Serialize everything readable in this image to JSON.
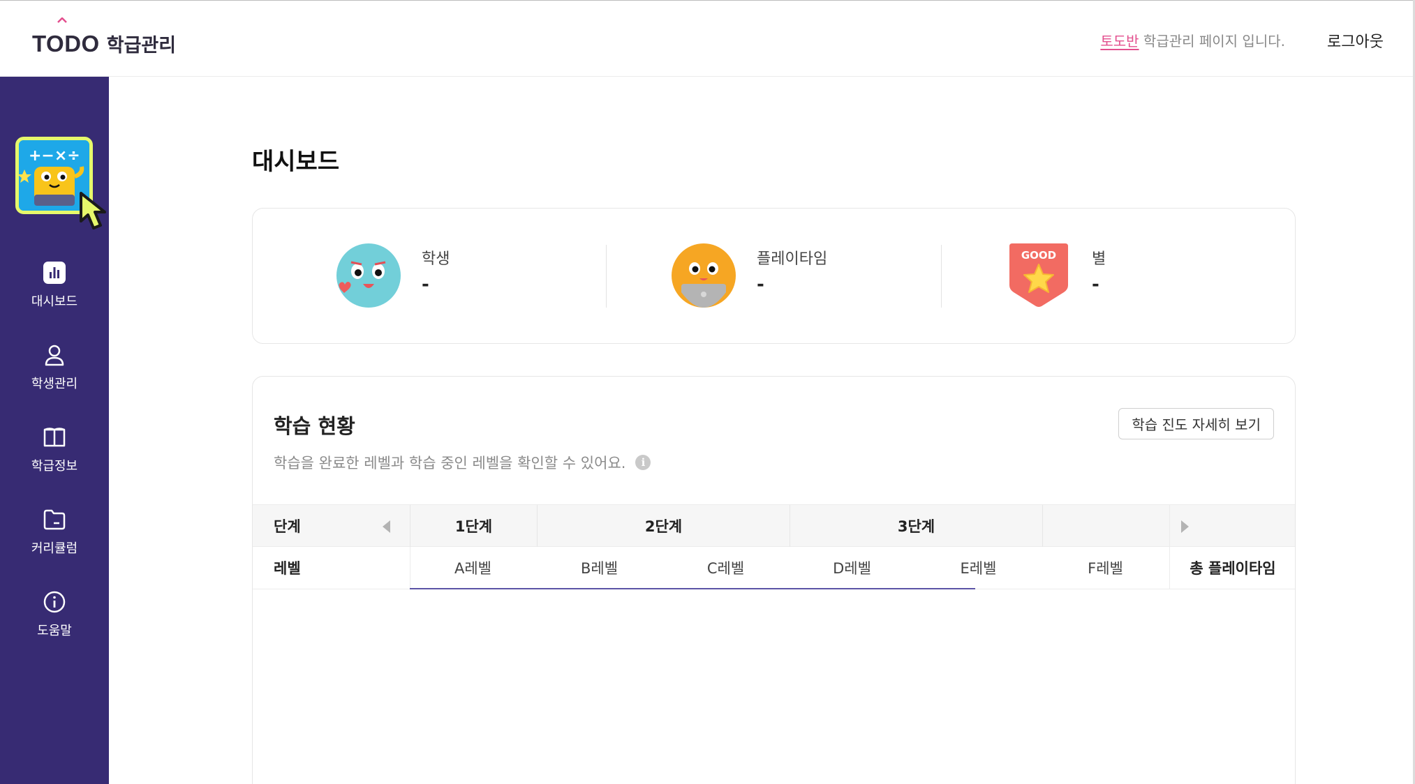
{
  "header": {
    "logo_text": "TODO",
    "logo_sub": "학급관리",
    "class_name": "토도반",
    "message": " 학급관리 페이지 입니다.",
    "logout_label": "로그아웃"
  },
  "sidebar": {
    "items": [
      {
        "label": "대시보드",
        "icon": "chart-icon"
      },
      {
        "label": "학생관리",
        "icon": "person-icon"
      },
      {
        "label": "학급정보",
        "icon": "book-icon"
      },
      {
        "label": "커리큘럼",
        "icon": "folder-icon"
      },
      {
        "label": "도움말",
        "icon": "info-icon"
      }
    ]
  },
  "main": {
    "title": "대시보드",
    "stats": [
      {
        "label": "학생",
        "value": "-"
      },
      {
        "label": "플레이타임",
        "value": "-"
      },
      {
        "label": "별",
        "value": "-",
        "badge_text": "GOOD"
      }
    ],
    "progress": {
      "title": "학습 현황",
      "description": "학습을 완료한 레벨과 학습 중인 레벨을 확인할 수 있어요.",
      "detail_button": "학습 진도 자세히 보기",
      "stage_header": "단계",
      "level_header": "레벨",
      "stages": [
        "1단계",
        "2단계",
        "3단계"
      ],
      "levels": [
        "A레벨",
        "B레벨",
        "C레벨",
        "D레벨",
        "E레벨",
        "F레벨"
      ],
      "total_playtime_header": "총 플레이타임"
    }
  },
  "colors": {
    "sidebar_bg": "#372b73",
    "accent_pink": "#e34f8e",
    "highlight": "#e6f86b",
    "progress_line": "#5b53a6"
  }
}
